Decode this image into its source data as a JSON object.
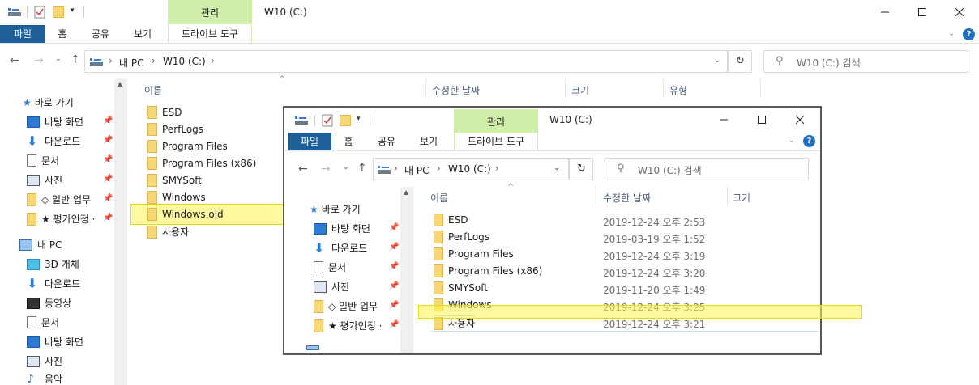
{
  "outer": {
    "title": "W10 (C:)",
    "manage_tab": "관리",
    "ribbon_tabs": [
      "파일",
      "홈",
      "공유",
      "보기",
      "드라이브 도구"
    ],
    "breadcrumb": [
      "내 PC",
      "W10 (C:)"
    ],
    "search_placeholder": "W10 (C:) 검색",
    "columns": [
      "이름",
      "수정한 날짜",
      "크기",
      "유형"
    ],
    "nav_quick_access": "바로 가기",
    "nav_items": [
      {
        "label": "바탕 화면",
        "icon": "desktop-icon",
        "pinned": true
      },
      {
        "label": "다운로드",
        "icon": "download-icon",
        "pinned": true
      },
      {
        "label": "문서",
        "icon": "documents-icon",
        "pinned": true
      },
      {
        "label": "사진",
        "icon": "pictures-icon",
        "pinned": true
      },
      {
        "label": "◇ 일반 업무",
        "icon": "folder-icon",
        "pinned": true
      },
      {
        "label": "★ 평가인정 ·",
        "icon": "folder-icon",
        "pinned": true
      }
    ],
    "nav_this_pc": "내 PC",
    "nav_pc_items": [
      {
        "label": "3D 개체",
        "icon": "3d-objects-icon"
      },
      {
        "label": "다운로드",
        "icon": "download-icon"
      },
      {
        "label": "동영상",
        "icon": "videos-icon"
      },
      {
        "label": "문서",
        "icon": "documents-icon"
      },
      {
        "label": "바탕 화면",
        "icon": "desktop-icon"
      },
      {
        "label": "사진",
        "icon": "pictures-icon"
      },
      {
        "label": "음악",
        "icon": "music-icon"
      }
    ],
    "files": [
      "ESD",
      "PerfLogs",
      "Program Files",
      "Program Files (x86)",
      "SMYSoft",
      "Windows",
      "Windows.old",
      "사용자"
    ]
  },
  "inner": {
    "title": "W10 (C:)",
    "manage_tab": "관리",
    "ribbon_tabs": [
      "파일",
      "홈",
      "공유",
      "보기",
      "드라이브 도구"
    ],
    "breadcrumb": [
      "내 PC",
      "W10 (C:)"
    ],
    "search_placeholder": "W10 (C:) 검색",
    "columns": [
      "이름",
      "수정한 날짜",
      "크기"
    ],
    "nav_quick_access": "바로 가기",
    "nav_items": [
      {
        "label": "바탕 화면",
        "icon": "desktop-icon"
      },
      {
        "label": "다운로드",
        "icon": "download-icon"
      },
      {
        "label": "문서",
        "icon": "documents-icon"
      },
      {
        "label": "사진",
        "icon": "pictures-icon"
      },
      {
        "label": "◇ 일반 업무",
        "icon": "folder-icon"
      },
      {
        "label": "★ 평가인정 ·",
        "icon": "folder-icon"
      }
    ],
    "files": [
      {
        "name": "ESD",
        "date": "2019-12-24 오후 2:53"
      },
      {
        "name": "PerfLogs",
        "date": "2019-03-19 오후 1:52"
      },
      {
        "name": "Program Files",
        "date": "2019-12-24 오후 3:19"
      },
      {
        "name": "Program Files (x86)",
        "date": "2019-12-24 오후 3:20"
      },
      {
        "name": "SMYSoft",
        "date": "2019-11-20 오후 1:49"
      },
      {
        "name": "Windows",
        "date": "2019-12-24 오후 3:25"
      },
      {
        "name": "사용자",
        "date": "2019-12-24 오후 3:21"
      }
    ]
  },
  "colors": {
    "file_tab": "#1e5f99",
    "manage_tab": "#cfeeaa",
    "highlight": "#fff550",
    "folder": "#f8d775"
  }
}
